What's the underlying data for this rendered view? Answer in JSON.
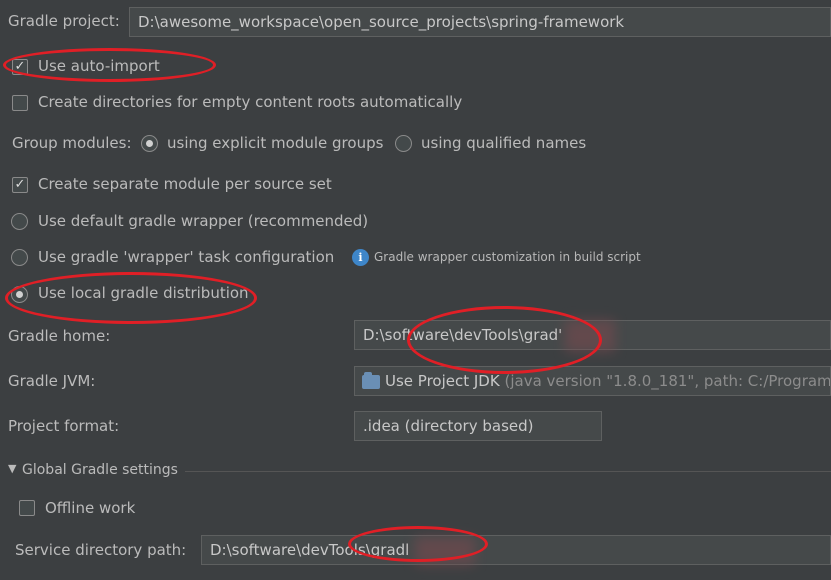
{
  "gradle_project": {
    "label": "Gradle project:",
    "value": "D:\\awesome_workspace\\open_source_projects\\spring-framework"
  },
  "options": {
    "auto_import": {
      "label": "Use auto-import",
      "checked": true
    },
    "create_dirs": {
      "label": "Create directories for empty content roots automatically",
      "checked": false
    },
    "separate_module": {
      "label": "Create separate module per source set",
      "checked": true
    }
  },
  "group_modules": {
    "label": "Group modules:",
    "explicit": "using explicit module groups",
    "qualified": "using qualified names",
    "selected": "explicit"
  },
  "distribution": {
    "default_wrapper": "Use default gradle wrapper (recommended)",
    "wrapper_task": "Use gradle 'wrapper' task configuration",
    "wrapper_hint": "Gradle wrapper customization in build script",
    "local": "Use local gradle distribution",
    "selected": "local"
  },
  "gradle_home": {
    "label": "Gradle home:",
    "value": "D:\\software\\devTools\\grad'"
  },
  "gradle_jvm": {
    "label": "Gradle JVM:",
    "value": "Use Project JDK",
    "detail": "(java version \"1.8.0_181\", path: C:/Program"
  },
  "project_format": {
    "label": "Project format:",
    "value": ".idea (directory based)"
  },
  "global_settings": {
    "header": "Global Gradle settings",
    "offline": {
      "label": "Offline work",
      "checked": false
    },
    "service_dir": {
      "label": "Service directory path:",
      "value": "D:\\software\\devTools\\gradl"
    }
  },
  "colors": {
    "background": "#3c3f41",
    "annotation": "#e01f26",
    "info": "#3e86c9"
  }
}
